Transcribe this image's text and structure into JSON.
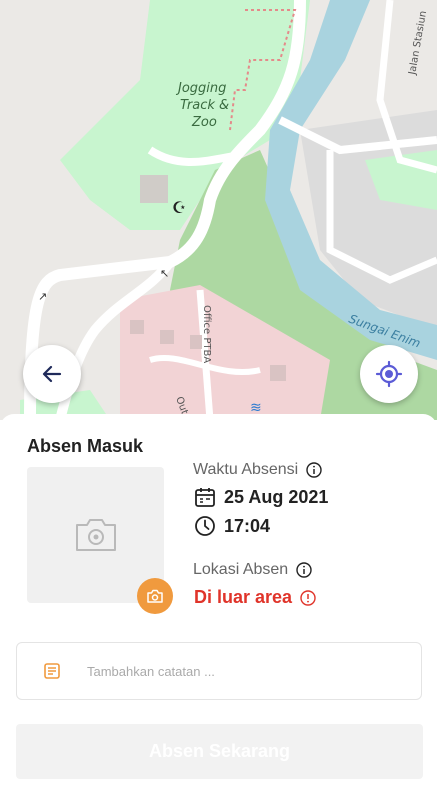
{
  "map": {
    "labels": {
      "jogging_line1": "Jogging",
      "jogging_line2": "Track &",
      "jogging_line3": "Zoo",
      "street_jalan": "Jalan Stasiun",
      "street_office": "Office PTBA",
      "river": "Sungai Enim",
      "street_out": "Out"
    }
  },
  "buttons": {
    "back": "back-arrow-icon",
    "locate": "locate-icon"
  },
  "attendance": {
    "title": "Absen Masuk",
    "time_label": "Waktu Absensi",
    "date": "25 Aug 2021",
    "time": "17:04",
    "location_label": "Lokasi Absen",
    "location_status": "Di luar area",
    "note_placeholder": "Tambahkan catatan ...",
    "submit_label": "Absen Sekarang"
  },
  "colors": {
    "accent": "#f09a3e",
    "error": "#e0342a",
    "primary_icon": "#5b5bd6",
    "map_green": "#c8f5cf",
    "map_river": "#a9d3df"
  }
}
